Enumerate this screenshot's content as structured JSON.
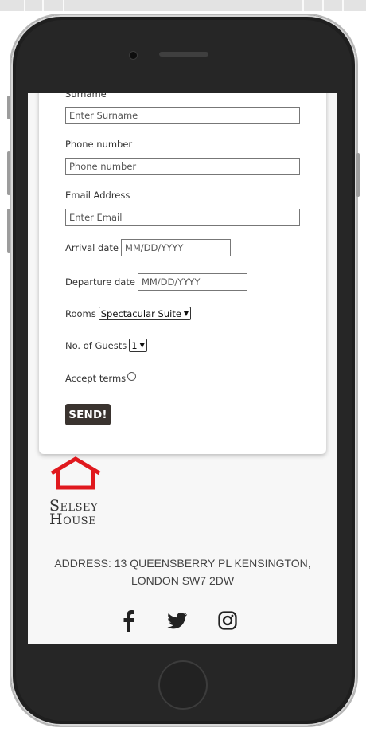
{
  "form": {
    "surname_label": "Surname",
    "surname_placeholder": "Enter Surname",
    "phone_label": "Phone number",
    "phone_placeholder": "Phone number",
    "email_label": "Email Address",
    "email_placeholder": "Enter Email",
    "arrival_label": "Arrival date",
    "arrival_placeholder": "MM/DD/YYYY",
    "departure_label": "Departure date",
    "departure_placeholder": "MM/DD/YYYY",
    "rooms_label": "Rooms",
    "rooms_selected": "Spectacular Suite",
    "guests_label": "No. of Guests",
    "guests_selected": "1",
    "terms_label": "Accept terms",
    "send_label": "SEND!"
  },
  "footer": {
    "logo_line1": "Selsey",
    "logo_line2": "House",
    "address_line1": "ADDRESS: 13 QUEENSBERRY PL KENSINGTON,",
    "address_line2": "LONDON SW7 2DW",
    "social_icons": [
      "facebook-icon",
      "twitter-icon",
      "instagram-icon"
    ]
  },
  "colors": {
    "brand_red": "#e0191e",
    "button_bg": "#3a332f"
  }
}
